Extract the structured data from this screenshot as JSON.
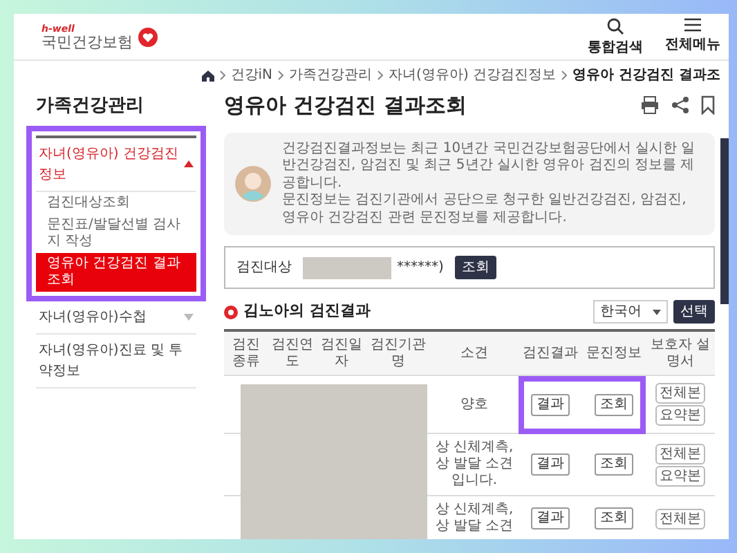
{
  "header": {
    "logo_tag": "h-well",
    "logo_text": "국민건강보험",
    "actions": [
      {
        "kind": "search",
        "label": "통합검색"
      },
      {
        "kind": "menu",
        "label": "전체메뉴"
      }
    ]
  },
  "breadcrumb": [
    "건강iN",
    "가족건강관리",
    "자녀(영유아) 건강검진정보",
    "영유아 건강검진 결과조"
  ],
  "sidebar": {
    "title": "가족건강관리",
    "items": [
      {
        "kind": "group",
        "label": "자녀(영유아) 건강검진정보",
        "expanded": true,
        "highlighted": true,
        "children": [
          {
            "label": "검진대상조회",
            "selected": false
          },
          {
            "label": "문진표/발달선별 검사지 작성",
            "selected": false
          },
          {
            "label": "영유아 건강검진 결과조회",
            "selected": true
          }
        ]
      },
      {
        "kind": "group",
        "label": "자녀(영유아)수첩",
        "expanded": false,
        "highlighted": false
      },
      {
        "kind": "link",
        "label": "자녀(영유아)진료 및 투약정보"
      }
    ]
  },
  "page_title": "영유아 건강검진 결과조회",
  "info": [
    "건강검진결과정보는 최근 10년간 국민건강보험공단에서 실시한 일반건강검진, 암검진 및 최근 5년간 실시한 영유아 검진의 정보를 제공합니다.",
    "문진정보는 검진기관에서 공단으로 청구한 일반건강검진, 암검진, 영유아 건강검진 관련 문진정보를 제공합니다."
  ],
  "search": {
    "label": "검진대상",
    "masked_suffix": "******)",
    "button": "조회"
  },
  "results": {
    "title": "김노아의 검진결과",
    "language": "한국어",
    "select_button": "선택",
    "columns": [
      "검진종류",
      "검진연도",
      "검진일자",
      "검진기관명",
      "소견",
      "검진결과",
      "문진정보",
      "보호자 설명서"
    ],
    "rows": [
      {
        "opinion": "양호",
        "result_button": "결과",
        "survey_button": "조회",
        "guide_buttons": [
          "전체본",
          "요약본"
        ],
        "highlighted": true
      },
      {
        "opinion": "상 신체계측, 상 발달 소견 입니다.",
        "result_button": "결과",
        "survey_button": "조회",
        "guide_buttons": [
          "전체본",
          "요약본"
        ],
        "highlighted": false
      },
      {
        "opinion": "상 신체계측, 상 발달 소견",
        "result_button": "결과",
        "survey_button": "조회",
        "guide_buttons": [
          "전체본"
        ],
        "highlighted": false
      }
    ]
  }
}
